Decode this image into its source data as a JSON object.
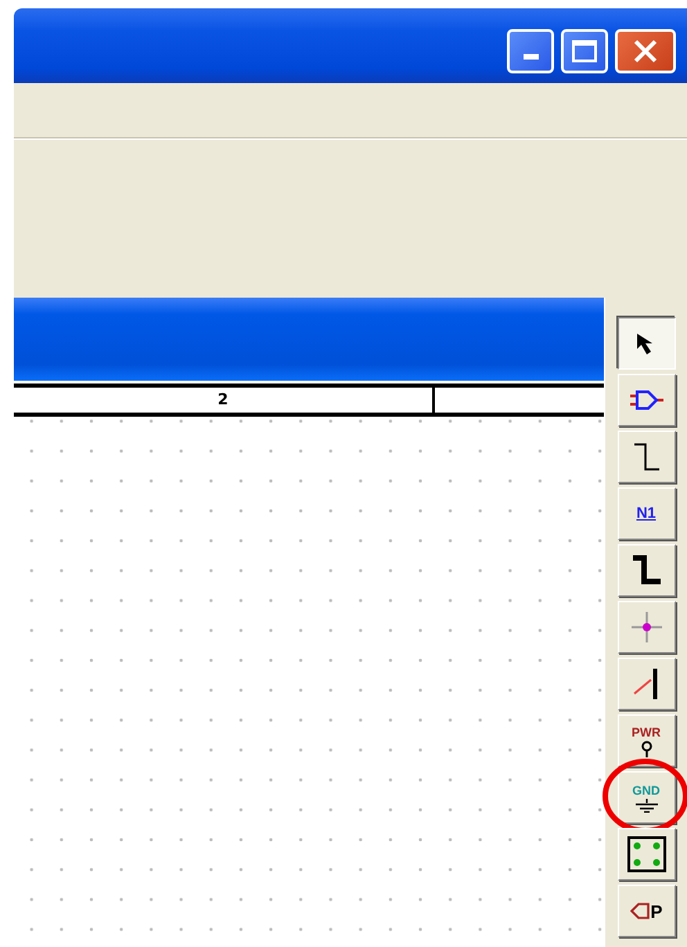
{
  "ruler": {
    "label": "2"
  },
  "tools": [
    {
      "kind": "select",
      "selected": true,
      "highlighted": false
    },
    {
      "kind": "gate",
      "selected": false,
      "highlighted": false
    },
    {
      "kind": "wire",
      "selected": false,
      "highlighted": false
    },
    {
      "kind": "netlabel",
      "label": "N1",
      "selected": false,
      "highlighted": false
    },
    {
      "kind": "bus",
      "selected": false,
      "highlighted": false
    },
    {
      "kind": "junction",
      "selected": false,
      "highlighted": false
    },
    {
      "kind": "busentry",
      "selected": false,
      "highlighted": false
    },
    {
      "kind": "power",
      "label": "PWR",
      "selected": false,
      "highlighted": false
    },
    {
      "kind": "ground",
      "label": "GND",
      "selected": false,
      "highlighted": true
    },
    {
      "kind": "part",
      "selected": false,
      "highlighted": false
    },
    {
      "kind": "offpage",
      "label": "P",
      "selected": false,
      "highlighted": false
    }
  ]
}
